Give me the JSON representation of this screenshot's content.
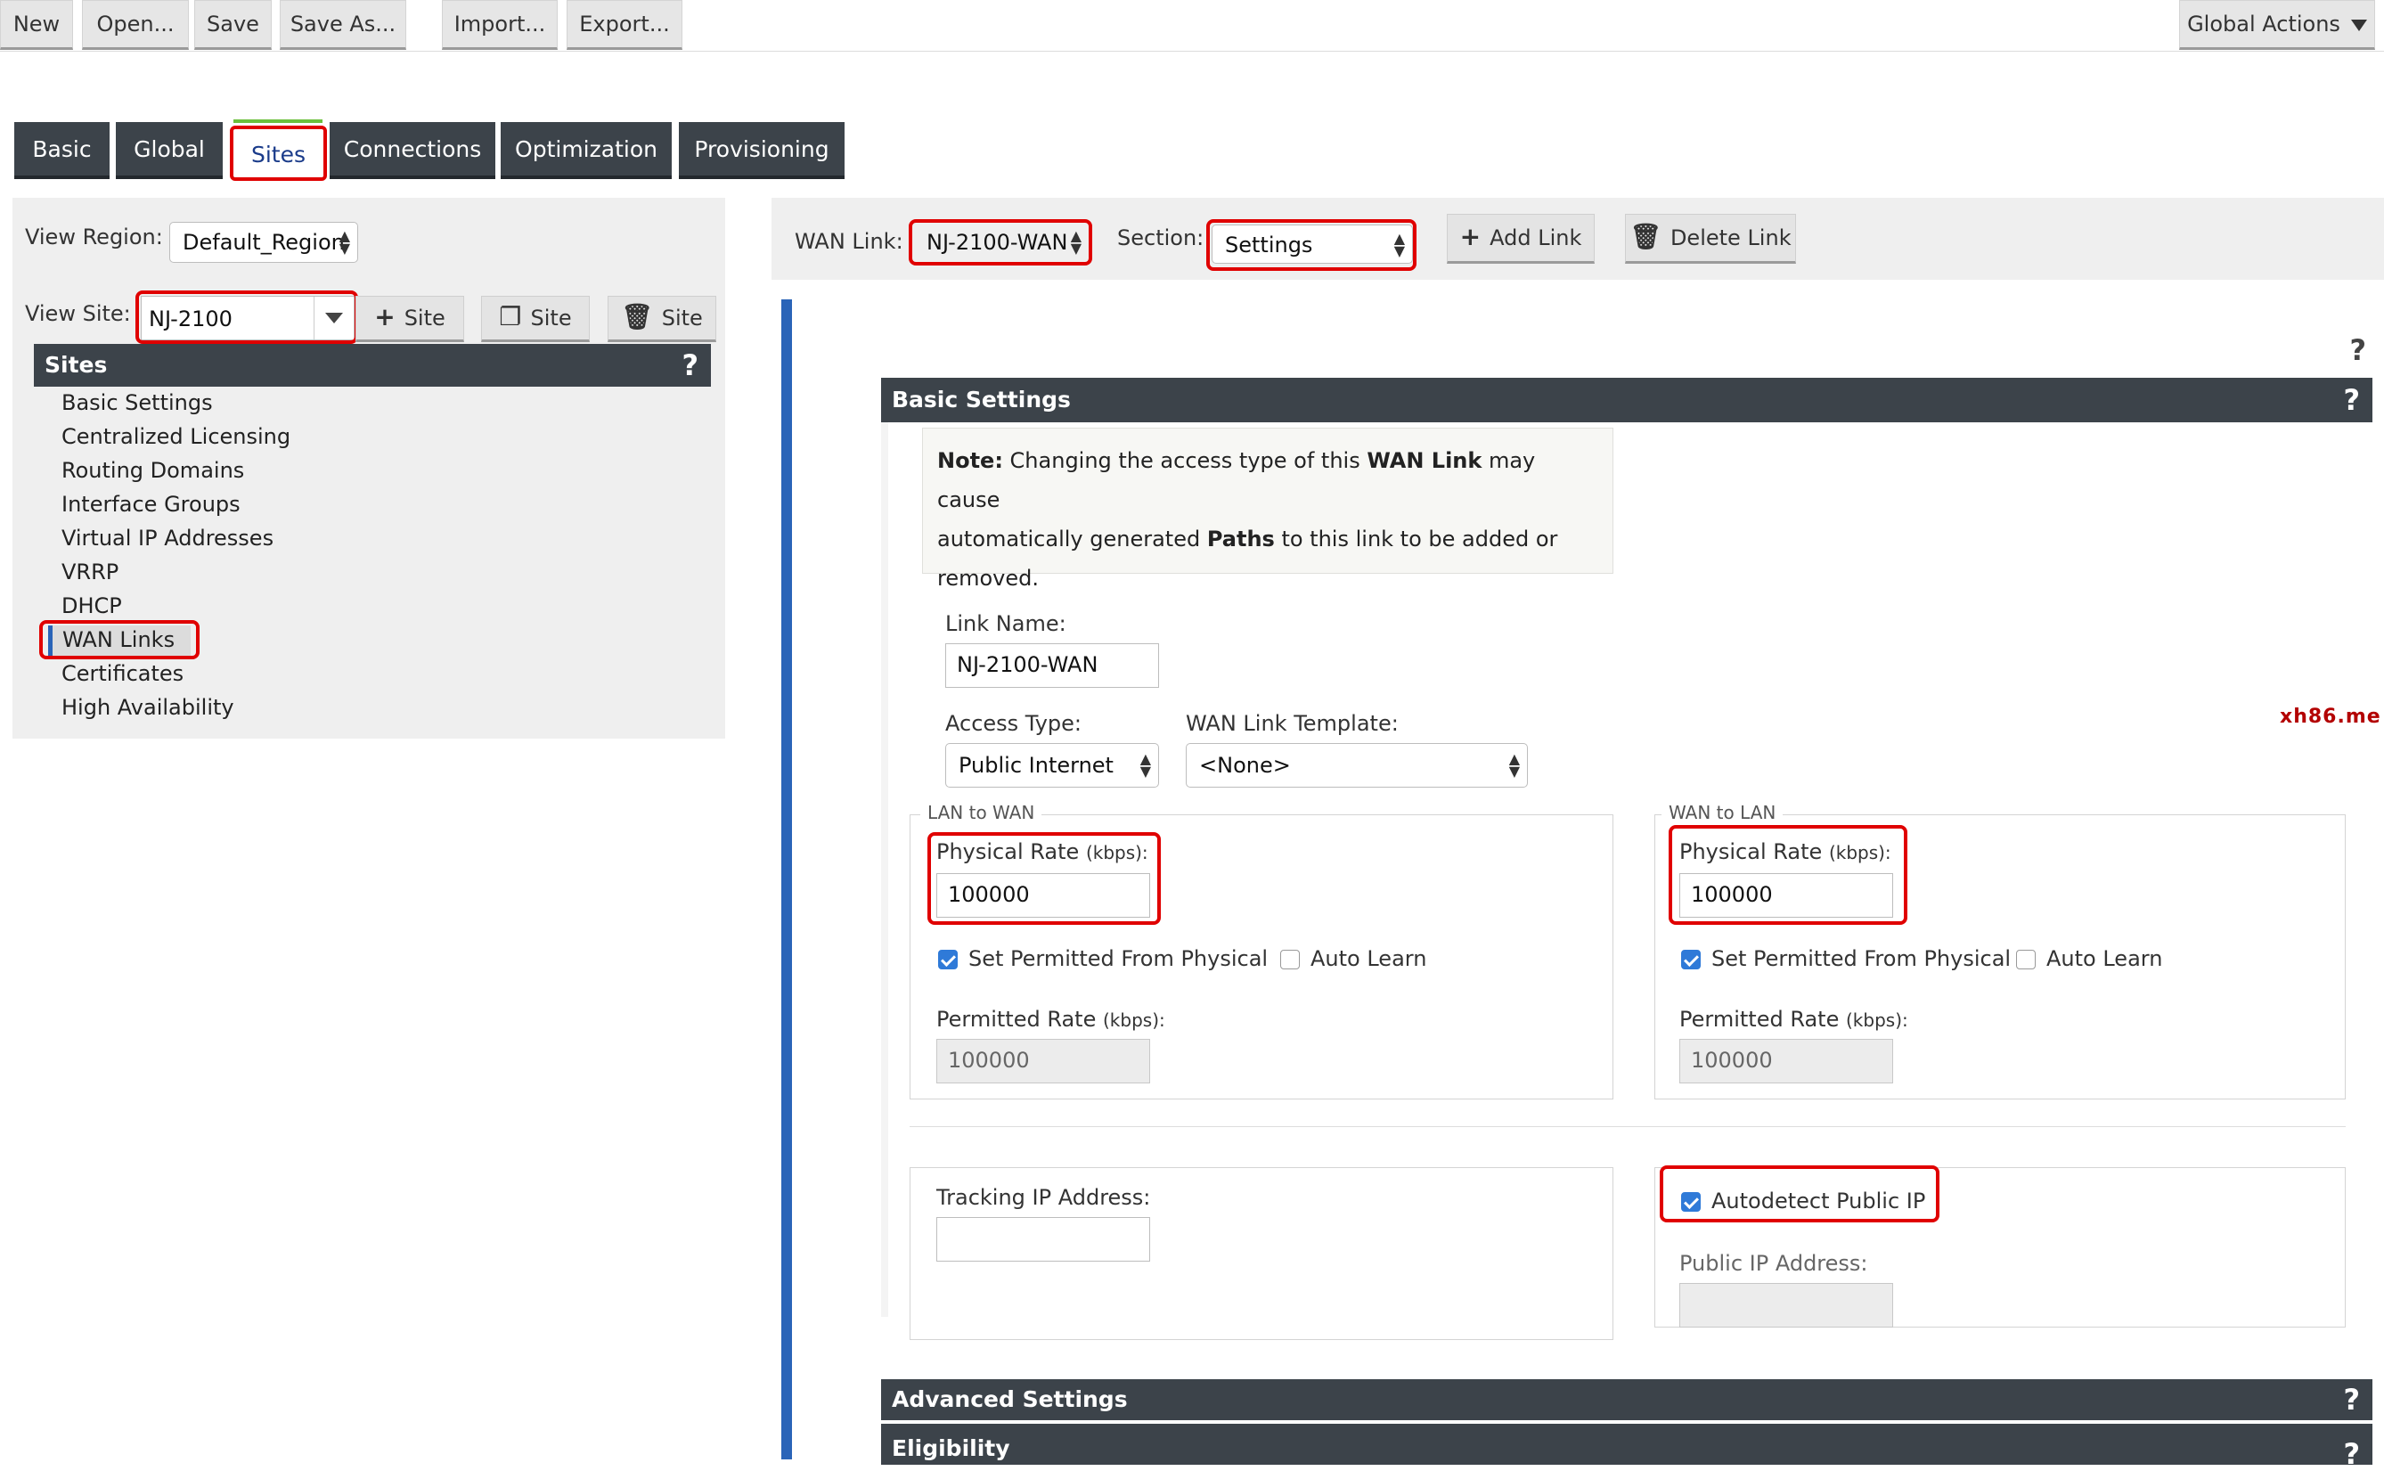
{
  "toolbar": {
    "new": "New",
    "open": "Open...",
    "save": "Save",
    "save_as": "Save As...",
    "import": "Import...",
    "export": "Export...",
    "global_actions": "Global Actions"
  },
  "tabs": [
    {
      "label": "Basic"
    },
    {
      "label": "Global"
    },
    {
      "label": "Sites"
    },
    {
      "label": "Connections"
    },
    {
      "label": "Optimization"
    },
    {
      "label": "Provisioning"
    }
  ],
  "left": {
    "view_region_label": "View Region:",
    "view_region_value": "Default_Region",
    "view_site_label": "View Site:",
    "view_site_value": "NJ-2100",
    "add_site": "Site",
    "copy_site": "Site",
    "delete_site": "Site",
    "sites_header": "Sites",
    "help": "?",
    "nav": [
      "Basic Settings",
      "Centralized Licensing",
      "Routing Domains",
      "Interface Groups",
      "Virtual IP Addresses",
      "VRRP",
      "DHCP",
      "WAN Links",
      "Certificates",
      "High Availability"
    ]
  },
  "topbar": {
    "wan_link_label": "WAN Link:",
    "wan_link_value": "NJ-2100-WAN",
    "section_label": "Section:",
    "section_value": "Settings",
    "add_link": "Add Link",
    "delete_link": "Delete Link"
  },
  "content": {
    "help": "?",
    "basic_settings": "Basic Settings",
    "note_bold1": "Note:",
    "note_text1": " Changing the access type of this ",
    "note_bold2": "WAN Link",
    "note_text2": " may cause",
    "note_text3": "automatically generated ",
    "note_bold3": "Paths",
    "note_text4": " to this link to be added or",
    "note_text5": "removed.",
    "link_name_label": "Link Name:",
    "link_name_value": "NJ-2100-WAN",
    "access_type_label": "Access Type:",
    "access_type_value": "Public Internet",
    "template_label": "WAN Link Template:",
    "template_value": "<None>",
    "watermark": "xh86.me",
    "lan_to_wan": "LAN to WAN",
    "wan_to_lan": "WAN to LAN",
    "physical_rate": "Physical Rate",
    "kbps": "(kbps):",
    "lan_physical": "100000",
    "wan_physical": "100000",
    "set_permitted": "Set Permitted From Physical",
    "auto_learn": "Auto Learn",
    "permitted_rate": "Permitted Rate",
    "lan_permitted": "100000",
    "wan_permitted": "100000",
    "tracking_ip_label": "Tracking IP Address:",
    "autodetect": "Autodetect Public IP",
    "public_ip_label": "Public IP Address:",
    "advanced_settings": "Advanced Settings",
    "eligibility": "Eligibility"
  }
}
